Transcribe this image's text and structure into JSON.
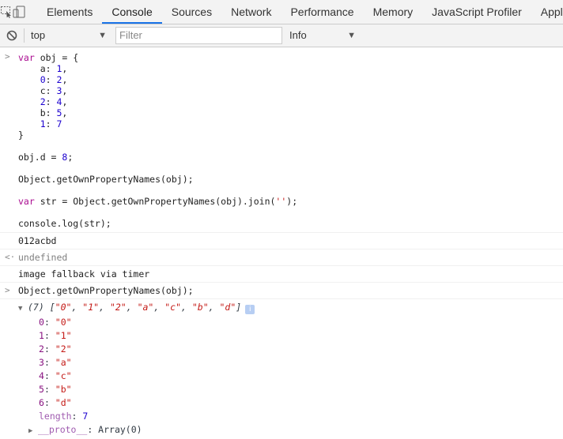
{
  "tabs": [
    {
      "label": "Elements"
    },
    {
      "label": "Console"
    },
    {
      "label": "Sources"
    },
    {
      "label": "Network"
    },
    {
      "label": "Performance"
    },
    {
      "label": "Memory"
    },
    {
      "label": "JavaScript Profiler"
    },
    {
      "label": "Appl"
    }
  ],
  "toolbar": {
    "context": "top",
    "filter_placeholder": "Filter",
    "levels": "Info"
  },
  "input1": {
    "lines": [
      "var obj = {",
      "    a: 1,",
      "    0: 2,",
      "    c: 3,",
      "    2: 4,",
      "    b: 5,",
      "    1: 7",
      "}",
      "",
      "obj.d = 8;",
      "",
      "Object.getOwnPropertyNames(obj);",
      "",
      "var str = Object.getOwnPropertyNames(obj).join('');",
      "",
      "console.log(str);"
    ]
  },
  "log_output": "012acbd",
  "return_value": "undefined",
  "fallback_text": "image fallback via timer",
  "input2": "Object.getOwnPropertyNames(obj);",
  "result": {
    "summary_count": "(7)",
    "summary_items": [
      "\"0\"",
      "\"1\"",
      "\"2\"",
      "\"a\"",
      "\"c\"",
      "\"b\"",
      "\"d\""
    ],
    "entries": [
      {
        "key": "0",
        "value": "\"0\""
      },
      {
        "key": "1",
        "value": "\"1\""
      },
      {
        "key": "2",
        "value": "\"2\""
      },
      {
        "key": "3",
        "value": "\"a\""
      },
      {
        "key": "4",
        "value": "\"c\""
      },
      {
        "key": "5",
        "value": "\"b\""
      },
      {
        "key": "6",
        "value": "\"d\""
      }
    ],
    "length_key": "length",
    "length_value": "7",
    "proto_key": "__proto__",
    "proto_value": "Array(0)"
  },
  "colors": {
    "active_tab": "#1a73e8",
    "string": "#c41a16",
    "number": "#1c00cf",
    "keyword": "#aa0d91",
    "property": "#881280"
  }
}
